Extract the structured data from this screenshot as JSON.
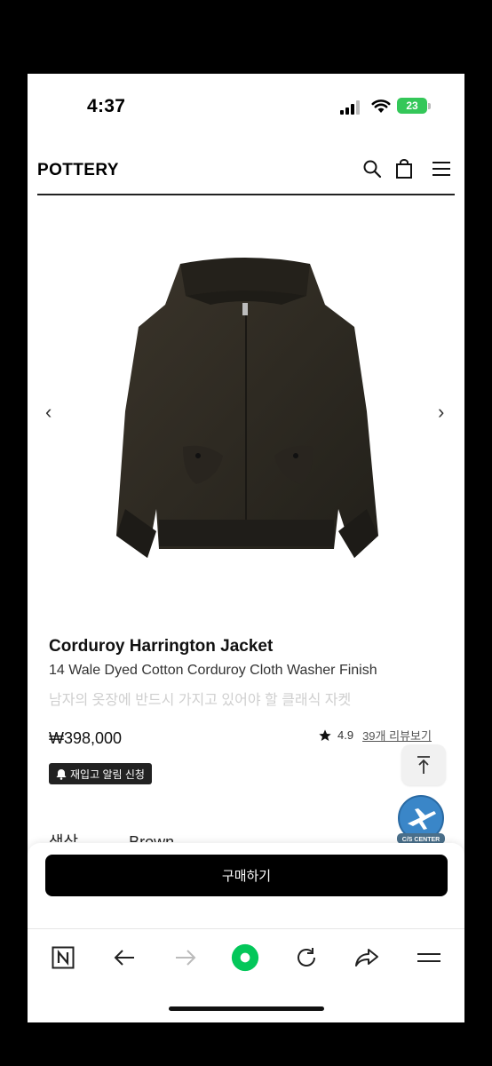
{
  "status": {
    "time": "4:37",
    "battery": "23"
  },
  "header": {
    "logo": "POTTERY",
    "icons": [
      "search-icon",
      "bag-icon",
      "menu-icon"
    ]
  },
  "gallery": {
    "prev": "‹",
    "next": "›"
  },
  "product": {
    "title": "Corduroy Harrington Jacket",
    "subtitle": "14 Wale Dyed Cotton Corduroy Cloth Washer Finish",
    "description": "남자의 옷장에 반드시 가지고 있어야 할 클래식 자켓",
    "price": "₩398,000",
    "rating": "4.9",
    "review_link": "39개 리뷰보기",
    "restock_label": "재입고 알림 신청",
    "partial_label": "색상",
    "partial_value": "Brown"
  },
  "floating": {
    "cs_label": "C/S CENTER"
  },
  "buy": {
    "label": "구매하기"
  },
  "browser": {
    "icons": [
      "naver-icon",
      "back-arrow-icon",
      "forward-arrow-icon",
      "green-home-icon",
      "refresh-icon",
      "share-icon",
      "hamburger-icon"
    ]
  },
  "colors": {
    "accent_green": "#03c75a",
    "battery_green": "#34c759"
  }
}
